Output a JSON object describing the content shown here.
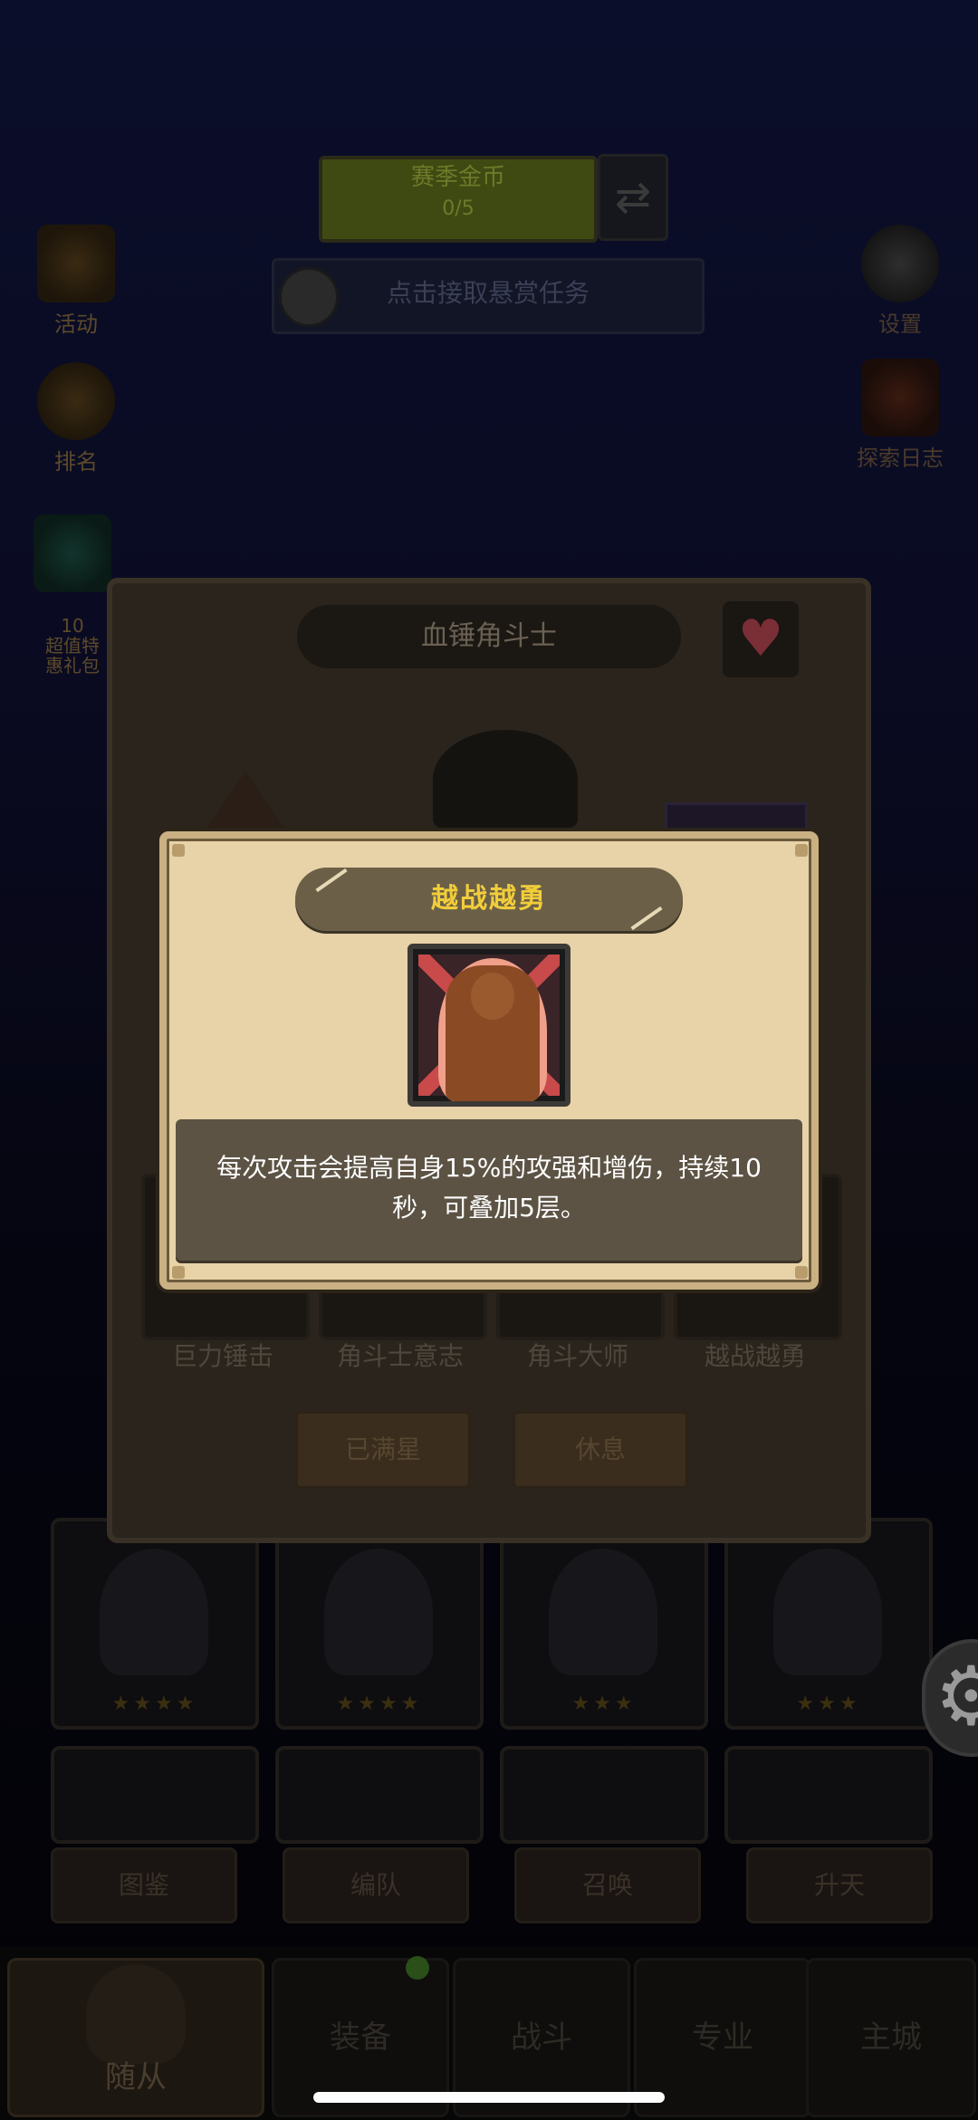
{
  "background": {
    "top_banner": {
      "title": "赛季金币",
      "sub": "0/5"
    },
    "task_bar": {
      "label": "点击接取悬赏任务"
    },
    "left_icons": [
      {
        "label": "活动"
      },
      {
        "label": "排名"
      },
      {
        "label": "10\n超值特\n惠礼包"
      }
    ],
    "right_icons": [
      {
        "label": "设置"
      },
      {
        "label": "探索日志"
      }
    ],
    "roster_stars": [
      "★★★★",
      "★★★★",
      "★★★",
      "★★★"
    ],
    "filter_buttons": [
      "图鉴",
      "编队",
      "召唤",
      "升天"
    ]
  },
  "hero_panel": {
    "name": "血锤角斗士",
    "skills": [
      "巨力锤击",
      "角斗士意志",
      "角斗大师",
      "越战越勇"
    ],
    "buttons": {
      "max_star": "已满星",
      "rest": "休息"
    }
  },
  "bottom_nav": {
    "tabs": [
      {
        "label": "随从",
        "active": true
      },
      {
        "label": "装备",
        "active": false
      },
      {
        "label": "战斗",
        "active": false
      },
      {
        "label": "专业",
        "active": false
      },
      {
        "label": "主城",
        "active": false
      }
    ]
  },
  "skill_popup": {
    "title": "越战越勇",
    "icon": "muscle-warrior-icon",
    "description": "每次攻击会提高自身15%的攻强和增伤，持续10秒，可叠加5层。"
  },
  "colors": {
    "popup_bg": "#e8d2a8",
    "title_text": "#f2cd3a",
    "desc_bg": "#5c5344",
    "overlay": "#000000"
  }
}
